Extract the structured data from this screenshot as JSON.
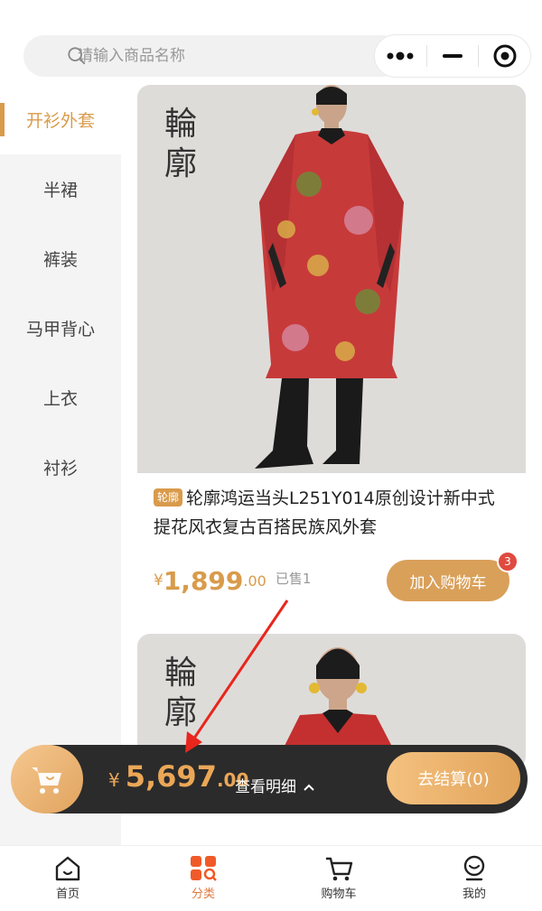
{
  "search": {
    "placeholder": "请输入商品名称"
  },
  "sidebar": {
    "items": [
      {
        "label": "开衫外套",
        "active": true
      },
      {
        "label": "半裙"
      },
      {
        "label": "裤装"
      },
      {
        "label": "马甲背心"
      },
      {
        "label": "上衣"
      },
      {
        "label": "衬衫"
      }
    ]
  },
  "products": [
    {
      "brand_mark": "輪\n廓",
      "tag": "轮廓",
      "title": "轮廓鸿运当头L251Y014原创设计新中式提花风衣复古百搭民族风外套",
      "price_currency": "¥",
      "price_int": "1,899",
      "price_dec": ".00",
      "sold": "已售1",
      "add_label": "加入购物车",
      "badge": "3"
    },
    {
      "brand_mark": "輪\n廓"
    }
  ],
  "cart": {
    "currency": "¥",
    "total_int": "5,697",
    "total_dec": ".00",
    "detail_label": "查看明细",
    "checkout_label": "去结算(0)"
  },
  "tabbar": {
    "items": [
      {
        "label": "首页",
        "icon": "home-icon"
      },
      {
        "label": "分类",
        "icon": "category-icon",
        "active": true
      },
      {
        "label": "购物车",
        "icon": "cart-icon"
      },
      {
        "label": "我的",
        "icon": "profile-icon"
      }
    ]
  },
  "colors": {
    "accent": "#d99b4b",
    "active_tab": "#e07a3c",
    "badge": "#e04a3f",
    "cart_bar": "#2b2b2b"
  }
}
